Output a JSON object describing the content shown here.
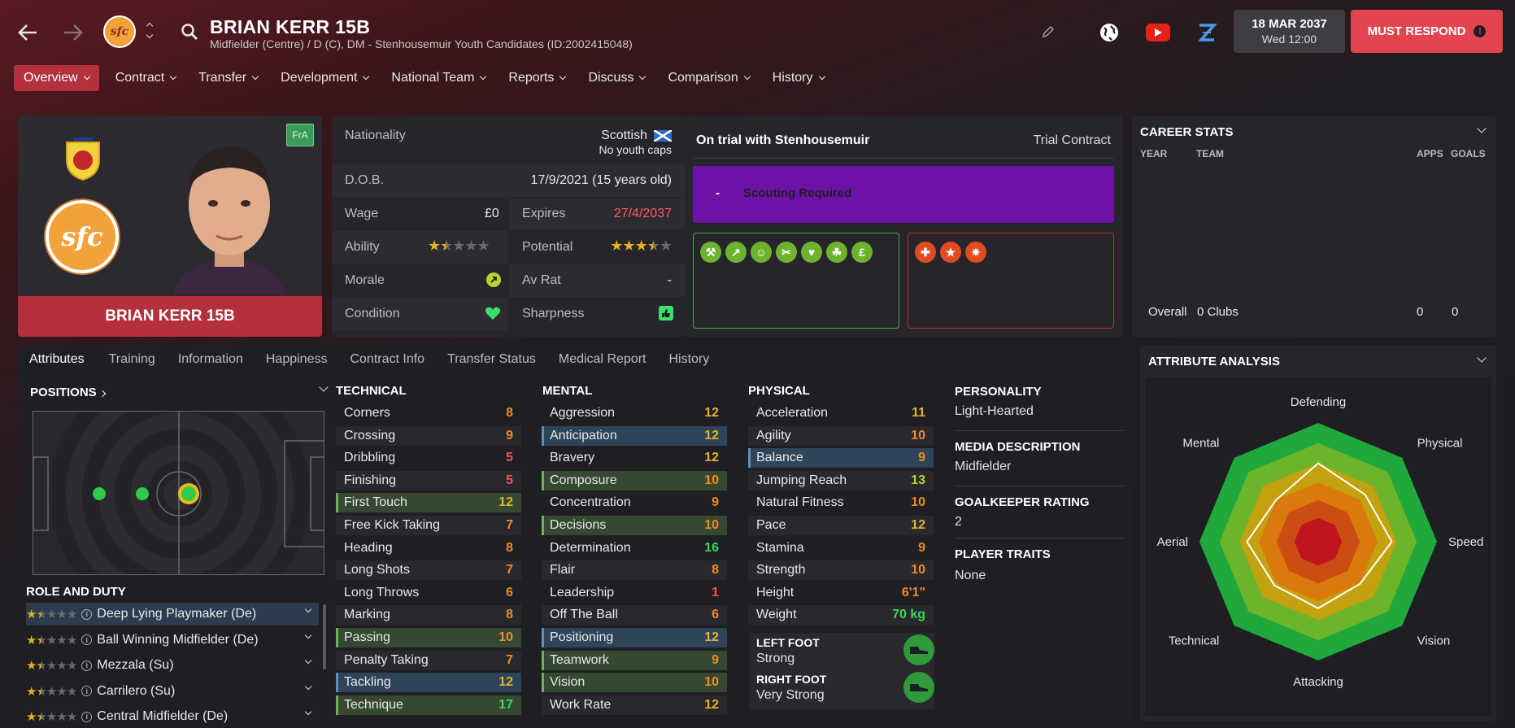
{
  "header": {
    "player_name": "BRIAN KERR 15B",
    "subtitle": "Midfielder (Centre) / D (C), DM - Stenhousemuir Youth Candidates (ID:2002415048)",
    "date": "18 MAR 2037",
    "day_time": "Wed 12:00",
    "must_respond": "MUST RESPOND",
    "club_badge_text": "sfc"
  },
  "nav": [
    "Overview",
    "Contract",
    "Transfer",
    "Development",
    "National Team",
    "Reports",
    "Discuss",
    "Comparison",
    "History"
  ],
  "profile": {
    "name_banner": "BRIAN KERR 15B",
    "tag": "FrA",
    "club_badge": "sfc"
  },
  "details": {
    "nationality_label": "Nationality",
    "nationality": "Scottish",
    "youth_caps": "No youth caps",
    "dob_label": "D.O.B.",
    "dob": "17/9/2021 (15 years old)",
    "wage_label": "Wage",
    "wage": "£0",
    "expires_label": "Expires",
    "expires": "27/4/2037",
    "ability_label": "Ability",
    "ability_stars": 1.5,
    "potential_label": "Potential",
    "potential_stars": 3.5,
    "morale_label": "Morale",
    "avrat_label": "Av Rat",
    "avrat": "-",
    "condition_label": "Condition",
    "sharpness_label": "Sharpness"
  },
  "trial": {
    "title": "On trial with Stenhousemuir",
    "contract": "Trial Contract",
    "dash": "-",
    "scouting": "Scouting Required",
    "good_icons": [
      "wrench-icon",
      "trend-up-icon",
      "head-icon",
      "syringe-icon",
      "foot-icon",
      "leaves-icon",
      "money-icon"
    ],
    "bad_icons": [
      "injury-icon",
      "star-icon",
      "burst-icon"
    ],
    "good_color": "#6db32e",
    "bad_color": "#e24a20"
  },
  "career": {
    "title": "CAREER STATS",
    "cols": [
      "YEAR",
      "TEAM",
      "APPS",
      "GOALS"
    ],
    "overall_label": "Overall",
    "overall_team": "0 Clubs",
    "overall_apps": "0",
    "overall_goals": "0"
  },
  "subtabs": [
    "Attributes",
    "Training",
    "Information",
    "Happiness",
    "Contract Info",
    "Transfer Status",
    "Medical Report",
    "History"
  ],
  "positions_title": "POSITIONS",
  "role_duty_title": "ROLE AND DUTY",
  "roles": [
    {
      "name": "Deep Lying Playmaker (De)",
      "stars": 1.5
    },
    {
      "name": "Ball Winning Midfielder (De)",
      "stars": 1.5
    },
    {
      "name": "Mezzala (Su)",
      "stars": 1.5
    },
    {
      "name": "Carrilero (Su)",
      "stars": 1.5
    },
    {
      "name": "Central Midfielder (De)",
      "stars": 1.5
    }
  ],
  "technical": {
    "title": "TECHNICAL",
    "rows": [
      {
        "name": "Corners",
        "value": "8"
      },
      {
        "name": "Crossing",
        "value": "9"
      },
      {
        "name": "Dribbling",
        "value": "5"
      },
      {
        "name": "Finishing",
        "value": "5"
      },
      {
        "name": "First Touch",
        "value": "12"
      },
      {
        "name": "Free Kick Taking",
        "value": "7"
      },
      {
        "name": "Heading",
        "value": "8"
      },
      {
        "name": "Long Shots",
        "value": "7"
      },
      {
        "name": "Long Throws",
        "value": "6"
      },
      {
        "name": "Marking",
        "value": "8"
      },
      {
        "name": "Passing",
        "value": "10"
      },
      {
        "name": "Penalty Taking",
        "value": "7"
      },
      {
        "name": "Tackling",
        "value": "12"
      },
      {
        "name": "Technique",
        "value": "17"
      }
    ]
  },
  "mental": {
    "title": "MENTAL",
    "rows": [
      {
        "name": "Aggression",
        "value": "12"
      },
      {
        "name": "Anticipation",
        "value": "12"
      },
      {
        "name": "Bravery",
        "value": "12"
      },
      {
        "name": "Composure",
        "value": "10"
      },
      {
        "name": "Concentration",
        "value": "9"
      },
      {
        "name": "Decisions",
        "value": "10"
      },
      {
        "name": "Determination",
        "value": "16"
      },
      {
        "name": "Flair",
        "value": "8"
      },
      {
        "name": "Leadership",
        "value": "1"
      },
      {
        "name": "Off The Ball",
        "value": "6"
      },
      {
        "name": "Positioning",
        "value": "12"
      },
      {
        "name": "Teamwork",
        "value": "9"
      },
      {
        "name": "Vision",
        "value": "10"
      },
      {
        "name": "Work Rate",
        "value": "12"
      }
    ]
  },
  "physical": {
    "title": "PHYSICAL",
    "rows": [
      {
        "name": "Acceleration",
        "value": "11"
      },
      {
        "name": "Agility",
        "value": "10"
      },
      {
        "name": "Balance",
        "value": "9"
      },
      {
        "name": "Jumping Reach",
        "value": "13"
      },
      {
        "name": "Natural Fitness",
        "value": "10"
      },
      {
        "name": "Pace",
        "value": "12"
      },
      {
        "name": "Stamina",
        "value": "9"
      },
      {
        "name": "Strength",
        "value": "10"
      },
      {
        "name": "Height",
        "value": "6'1\""
      },
      {
        "name": "Weight",
        "value": "70 kg"
      }
    ],
    "left_foot_label": "LEFT FOOT",
    "left_foot": "Strong",
    "right_foot_label": "RIGHT FOOT",
    "right_foot": "Very Strong"
  },
  "personality": {
    "personality_title": "PERSONALITY",
    "personality": "Light-Hearted",
    "media_title": "MEDIA DESCRIPTION",
    "media": "Midfielder",
    "gk_title": "GOALKEEPER RATING",
    "gk": "2",
    "traits_title": "PLAYER TRAITS",
    "traits": "None"
  },
  "analysis": {
    "title": "ATTRIBUTE ANALYSIS",
    "axes": [
      "Defending",
      "Physical",
      "Speed",
      "Vision",
      "Attacking",
      "Technical",
      "Aerial",
      "Mental"
    ],
    "values": [
      0.66,
      0.56,
      0.62,
      0.5,
      0.56,
      0.52,
      0.6,
      0.5
    ],
    "colors": {
      "outer": "#1fa83c",
      "band2": "#6cb52a",
      "band3": "#c4a10f",
      "band4": "#db7a0c",
      "band5": "#cc4c12",
      "core": "#c0141e"
    }
  }
}
